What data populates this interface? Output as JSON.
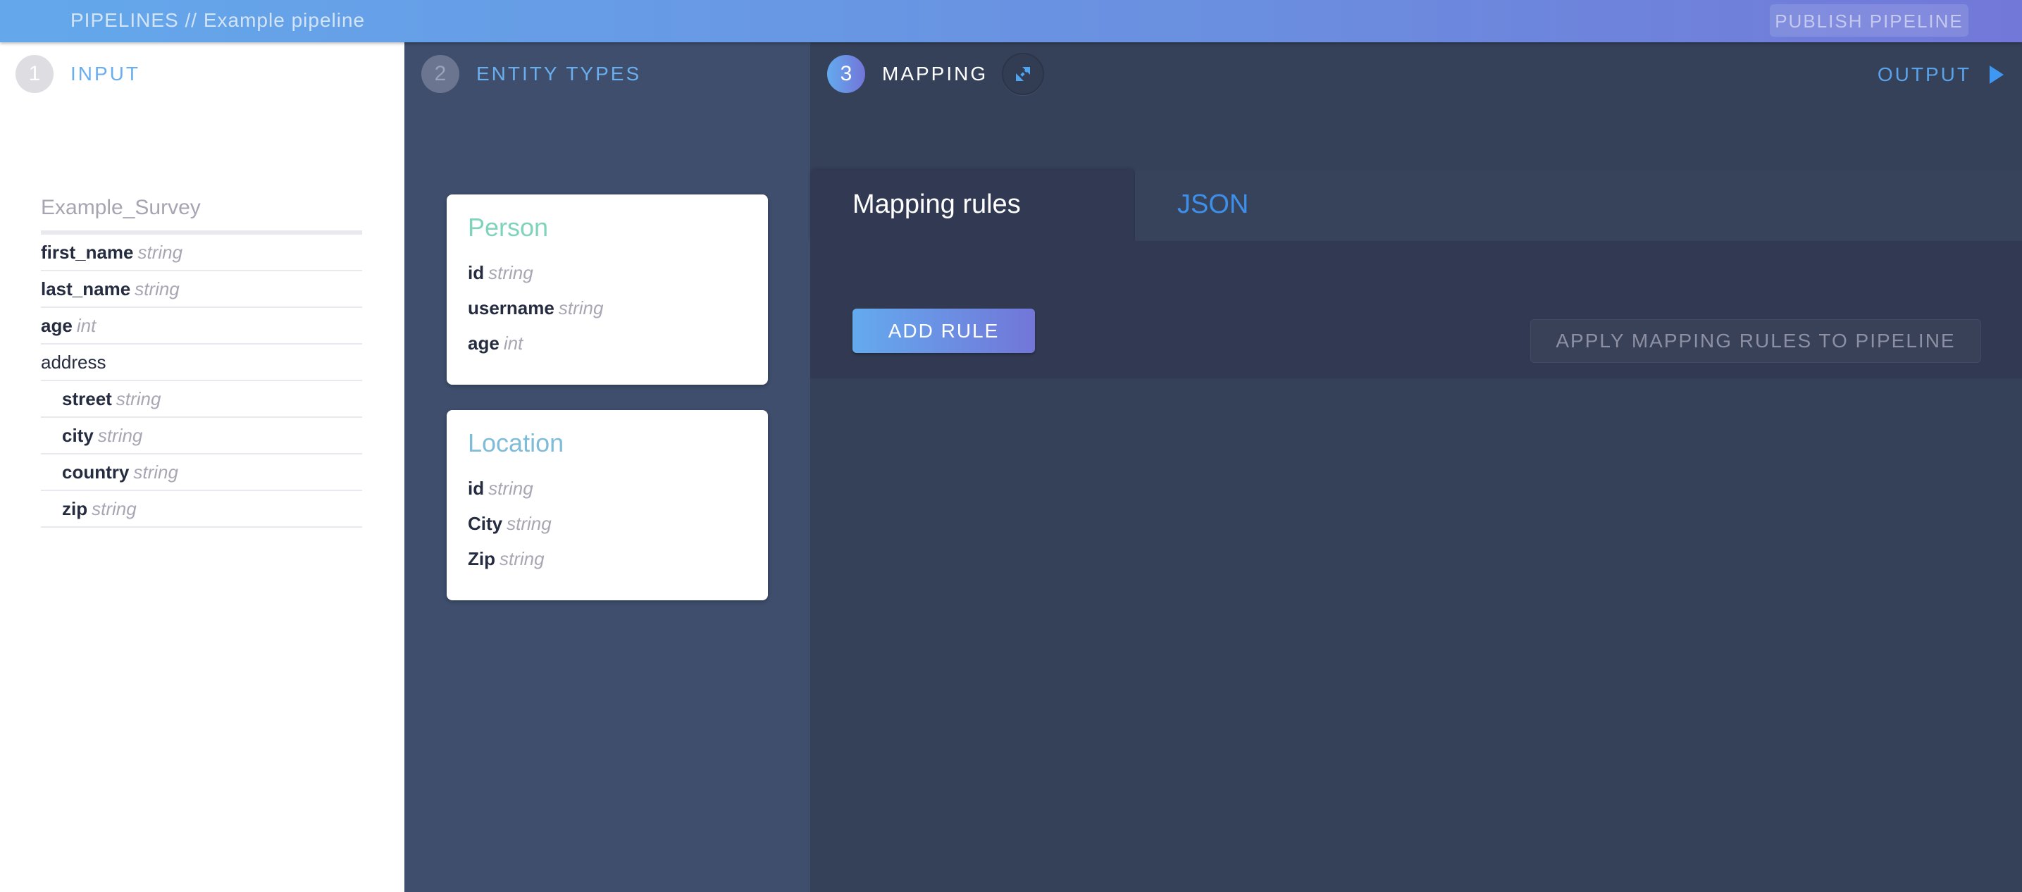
{
  "header": {
    "section": "PIPELINES",
    "separator": " // ",
    "pipeline_name": "Example pipeline",
    "publish_label": "PUBLISH PIPELINE"
  },
  "steps": [
    {
      "number": "1",
      "label": "INPUT"
    },
    {
      "number": "2",
      "label": "ENTITY TYPES"
    },
    {
      "number": "3",
      "label": "MAPPING"
    }
  ],
  "expand_icon": "expand-arrows-icon",
  "output": {
    "label": "OUTPUT",
    "icon": "play-triangle-icon"
  },
  "input": {
    "source_name": "Example_Survey",
    "fields": [
      {
        "name": "first_name",
        "type": "string",
        "level": 0
      },
      {
        "name": "last_name",
        "type": "string",
        "level": 0
      },
      {
        "name": "age",
        "type": "int",
        "level": 0
      },
      {
        "name": "address",
        "type": "",
        "level": 0,
        "group": true
      },
      {
        "name": "street",
        "type": "string",
        "level": 1
      },
      {
        "name": "city",
        "type": "string",
        "level": 1
      },
      {
        "name": "country",
        "type": "string",
        "level": 1
      },
      {
        "name": "zip",
        "type": "string",
        "level": 1
      }
    ]
  },
  "entity_types": [
    {
      "name": "Person",
      "color": "#7fd3bb",
      "fields": [
        {
          "name": "id",
          "type": "string"
        },
        {
          "name": "username",
          "type": "string"
        },
        {
          "name": "age",
          "type": "int"
        }
      ]
    },
    {
      "name": "Location",
      "color": "#7fbcd8",
      "fields": [
        {
          "name": "id",
          "type": "string"
        },
        {
          "name": "City",
          "type": "string"
        },
        {
          "name": "Zip",
          "type": "string"
        }
      ]
    }
  ],
  "mapping": {
    "tabs": [
      {
        "label": "Mapping rules",
        "active": true
      },
      {
        "label": "JSON",
        "active": false
      }
    ],
    "add_rule_label": "ADD RULE",
    "apply_label": "APPLY MAPPING RULES TO PIPELINE"
  },
  "colors": {
    "accent": "#64aaee",
    "accent_end": "#7276d8",
    "link": "#3d90ea"
  }
}
